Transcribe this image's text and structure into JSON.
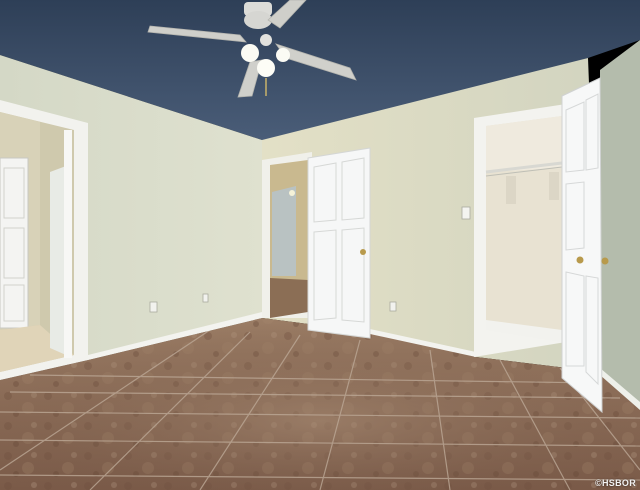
{
  "photo": {
    "watermark": "©HSBOR",
    "colors": {
      "ceiling": "#3a4d66",
      "wall_left": "#d9dcc9",
      "wall_back": "#dcdcc4",
      "wall_right": "#b9c0b0",
      "floor": "#8a6a55",
      "grout": "#b8a293",
      "door": "#f5f6f6",
      "trim": "#f1f2ef",
      "closet_interior": "#e6e0d0",
      "hall": "#d0c7a6"
    }
  }
}
